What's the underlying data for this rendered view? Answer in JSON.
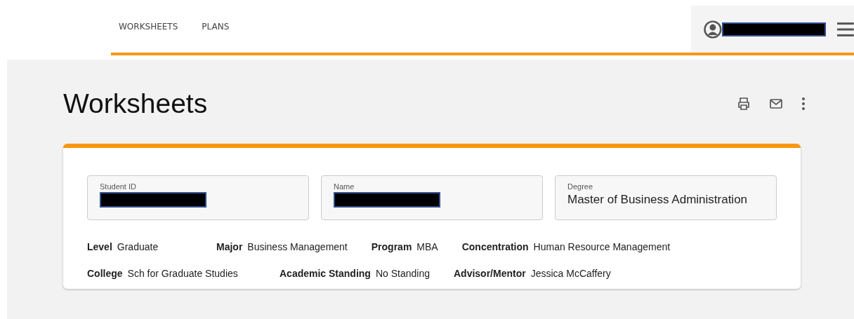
{
  "nav": {
    "links": [
      {
        "label": "WORKSHEETS"
      },
      {
        "label": "PLANS"
      }
    ]
  },
  "page": {
    "title": "Worksheets"
  },
  "student": {
    "fields": [
      {
        "label": "Student ID",
        "redacted": true
      },
      {
        "label": "Name",
        "redacted": true
      },
      {
        "label": "Degree",
        "value": "Master of Business Administration",
        "redacted": false
      }
    ],
    "info_rows": [
      [
        {
          "label": "Level",
          "value": "Graduate"
        },
        {
          "label": "Major",
          "value": "Business Management"
        },
        {
          "label": "Program",
          "value": "MBA"
        },
        {
          "label": "Concentration",
          "value": "Human Resource Management"
        }
      ],
      [
        {
          "label": "College",
          "value": "Sch for Graduate Studies"
        },
        {
          "label": "Academic Standing",
          "value": "No Standing"
        },
        {
          "label": "Advisor/Mentor",
          "value": "Jessica McCaffery"
        }
      ]
    ]
  }
}
